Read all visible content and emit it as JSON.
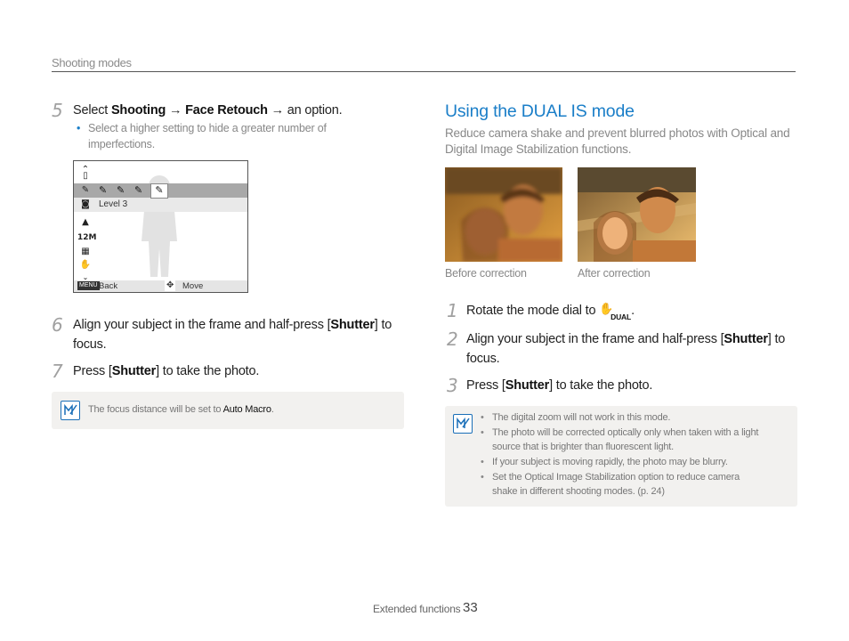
{
  "header": {
    "section": "Shooting modes"
  },
  "left": {
    "step5": {
      "num": "5",
      "pre": "Select ",
      "b1": "Shooting",
      "arrow1": " → ",
      "b2": "Face Retouch",
      "post": " → an option.",
      "bullet": "Select a higher setting to hide a greater number of imperfections."
    },
    "screen": {
      "level_label": "Level 3",
      "back_label": "Back",
      "move_label": "Move",
      "menu_key": "MENU"
    },
    "step6": {
      "num": "6",
      "pre": "Align your subject in the frame and half-press [",
      "b": "Shutter",
      "post": "] to focus."
    },
    "step7": {
      "num": "7",
      "pre": "Press [",
      "b": "Shutter",
      "post": "] to take the photo."
    },
    "note": {
      "pre": "The focus distance will be set to ",
      "b": "Auto Macro",
      "post": "."
    }
  },
  "right": {
    "title": "Using the DUAL IS mode",
    "desc": "Reduce camera shake and prevent blurred photos with Optical and Digital Image Stabilization functions.",
    "caption_before": "Before correction",
    "caption_after": "After correction",
    "step1": {
      "num": "1",
      "text": "Rotate the mode dial to",
      "icon_text": "DUAL",
      "post": "."
    },
    "step2": {
      "num": "2",
      "pre": "Align your subject in the frame and half-press [",
      "b": "Shutter",
      "post": "] to focus."
    },
    "step3": {
      "num": "3",
      "pre": "Press [",
      "b": "Shutter",
      "post": "] to take the photo."
    },
    "notes": [
      "The digital zoom will not work in this mode.",
      "The photo will be corrected optically only when taken with a light source that is brighter than fluorescent light.",
      "If your subject is moving rapidly, the photo may be blurry.",
      "Set the Optical Image Stabilization option to reduce camera shake in different shooting modes. (p. 24)"
    ]
  },
  "footer": {
    "label": "Extended functions",
    "page": "33"
  },
  "colors": {
    "accent": "#1a7ec8",
    "note_bg": "#f2f1ef"
  }
}
